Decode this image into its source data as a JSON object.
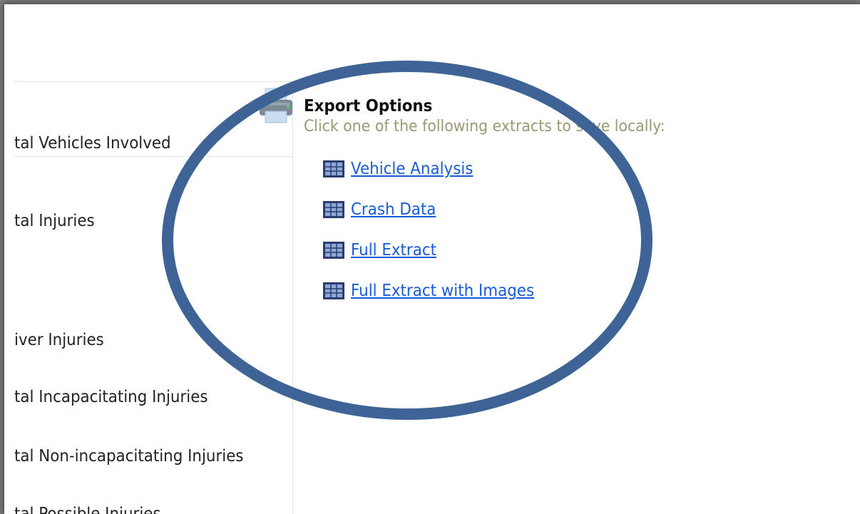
{
  "left_panel": {
    "stats": [
      {
        "label": "tal Vehicles Involved"
      },
      {
        "label": "tal Injuries"
      },
      {
        "label": "iver Injuries"
      },
      {
        "label": "tal Incapacitating Injuries"
      },
      {
        "label": "tal Non-incapacitating Injuries"
      },
      {
        "label": "tal Possible Injuries"
      }
    ]
  },
  "export": {
    "title": "Export Options",
    "instruction": "Click one of the following extracts to save locally:",
    "links": [
      {
        "label": "Vehicle Analysis",
        "icon": "table-icon"
      },
      {
        "label": "Crash Data",
        "icon": "table-icon"
      },
      {
        "label": "Full Extract",
        "icon": "table-icon"
      },
      {
        "label": "Full Extract with Images",
        "icon": "table-icon"
      }
    ]
  },
  "toolbar": {
    "print_icon": "printer-icon"
  },
  "colors": {
    "link": "#1a5bd6",
    "instruction": "#9a9a72",
    "highlight_ellipse": "#3e6495"
  }
}
